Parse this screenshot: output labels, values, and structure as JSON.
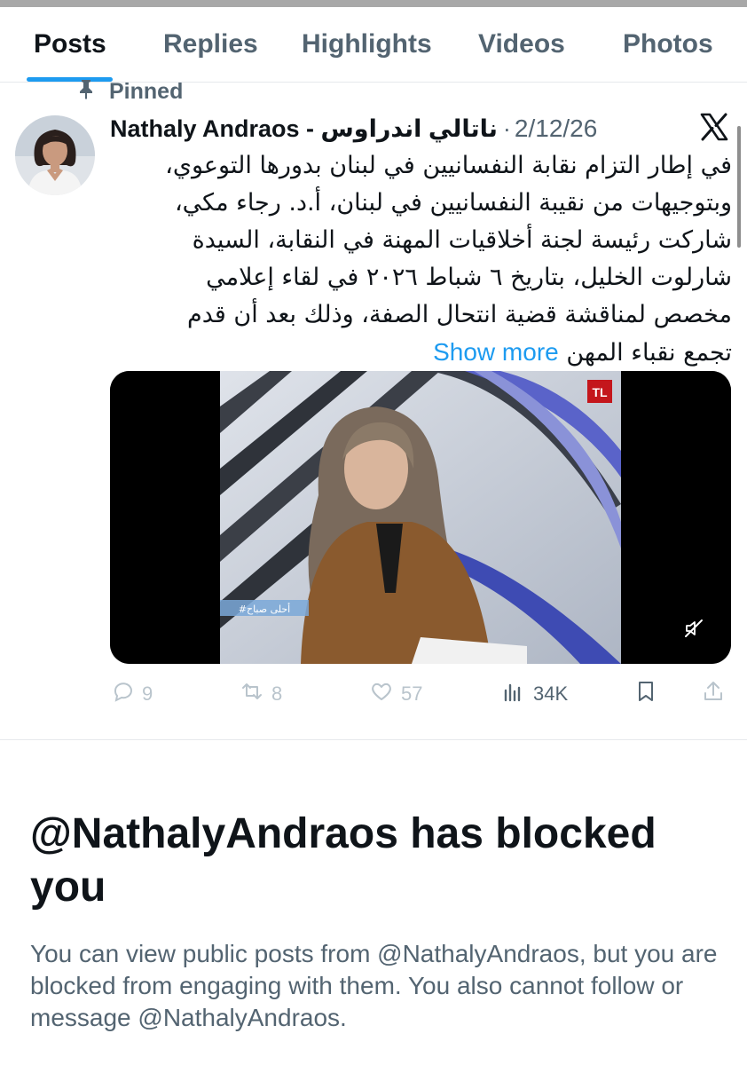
{
  "tabs": [
    {
      "label": "Posts",
      "active": true
    },
    {
      "label": "Replies",
      "active": false
    },
    {
      "label": "Highlights",
      "active": false
    },
    {
      "label": "Videos",
      "active": false
    },
    {
      "label": "Photos",
      "active": false
    }
  ],
  "pinned_label": "Pinned",
  "post": {
    "author_name": "Nathaly Andraos - ناتالي اندراوس",
    "date": "2/12/26",
    "text_lines": [
      "في إطار التزام نقابة النفسانيين في لبنان بدورها التوعوي،",
      "وبتوجيهات من نقيبة  النفسانيين في لبنان، أ.د. رجاء مكي،",
      "شاركت رئيسة لجنة أخلاقيات المهنة في النقابة، السيدة",
      "شارلوت الخليل، بتاريخ  ٦ شباط ٢٠٢٦ في لقاء إعلامي",
      "مخصص لمناقشة قضية انتحال الصفة، وذلك بعد أن قدم",
      "تجمع نقباء المهن"
    ],
    "show_more": "Show more",
    "video_channel_logo": "TL",
    "video_overlay_text": "#أحلى صباح",
    "stats": {
      "replies": "9",
      "reposts": "8",
      "likes": "57",
      "views": "34K"
    }
  },
  "blocked": {
    "title": "@NathalyAndraos has blocked you",
    "description": "You can view public posts from @NathalyAndraos, but you are blocked from engaging with them. You also cannot follow or message @NathalyAndraos."
  },
  "colors": {
    "accent": "#1d9bf0",
    "text_primary": "#0f1419",
    "text_secondary": "#536471",
    "action_faded": "#b9c4cc"
  },
  "icons": [
    "pin-icon",
    "x-logo-icon",
    "mute-icon",
    "reply-icon",
    "repost-icon",
    "like-icon",
    "views-icon",
    "bookmark-icon",
    "share-icon"
  ]
}
